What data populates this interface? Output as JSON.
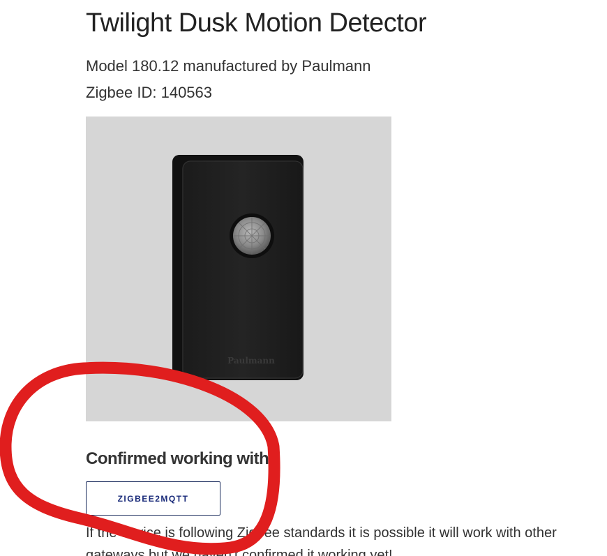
{
  "device": {
    "title": "Twilight Dusk Motion Detector",
    "model_line": "Model 180.12 manufactured by Paulmann",
    "zigbee_id": "Zigbee ID: 140563",
    "image_brand": "Paulmann"
  },
  "compatibility": {
    "heading": "Confirmed working with",
    "gateways": [
      "ZIGBEE2MQTT"
    ],
    "note": "If the device is following Zigbee standards it is possible it will work with other gateways but we haven't confirmed it working yet!"
  },
  "annotation": {
    "color": "#e01e1e"
  },
  "colors": {
    "image_background": "#d6d6d6",
    "button_text": "#1a2b7a"
  }
}
